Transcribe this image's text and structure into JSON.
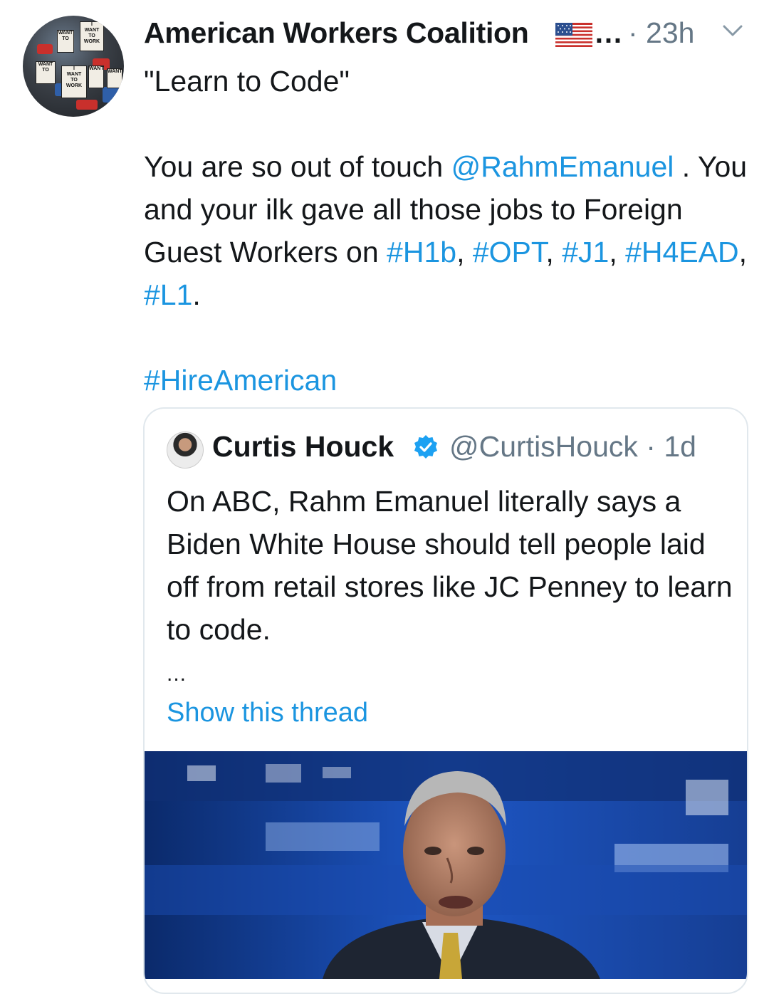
{
  "tweet": {
    "author_name": "American Workers Coalition",
    "name_truncation": "…",
    "time": "· 23h",
    "avatar_sign_text": [
      "I",
      "WANT",
      "TO",
      "WORK"
    ],
    "text": {
      "title": "\"Learn to Code\"",
      "line1_prefix": "You are so out of touch ",
      "mention": "@RahmEmanuel",
      "line1_suffix": " .",
      "line2_prefix": "You and your ilk gave all those jobs to Foreign Guest Workers on ",
      "hashtags": [
        "#H1b",
        "#OPT",
        "#J1",
        "#H4EAD",
        "#L1"
      ],
      "sep": ", ",
      "period": ".",
      "closing_hashtag": "#HireAmerican"
    }
  },
  "quoted": {
    "author_name": "Curtis Houck",
    "handle_time": "@CurtisHouck · 1d",
    "text": "On ABC, Rahm Emanuel literally says a Biden White House should tell people laid off from retail stores like JC Penney to learn to code.",
    "ellipsis": "...",
    "show_thread": "Show this thread"
  },
  "colors": {
    "link": "#1b95e0",
    "text": "#14171a",
    "secondary": "#657786",
    "border": "#e1e8ed"
  },
  "icons": [
    "flag-icon",
    "chevron-down-icon",
    "verified-badge-icon"
  ]
}
